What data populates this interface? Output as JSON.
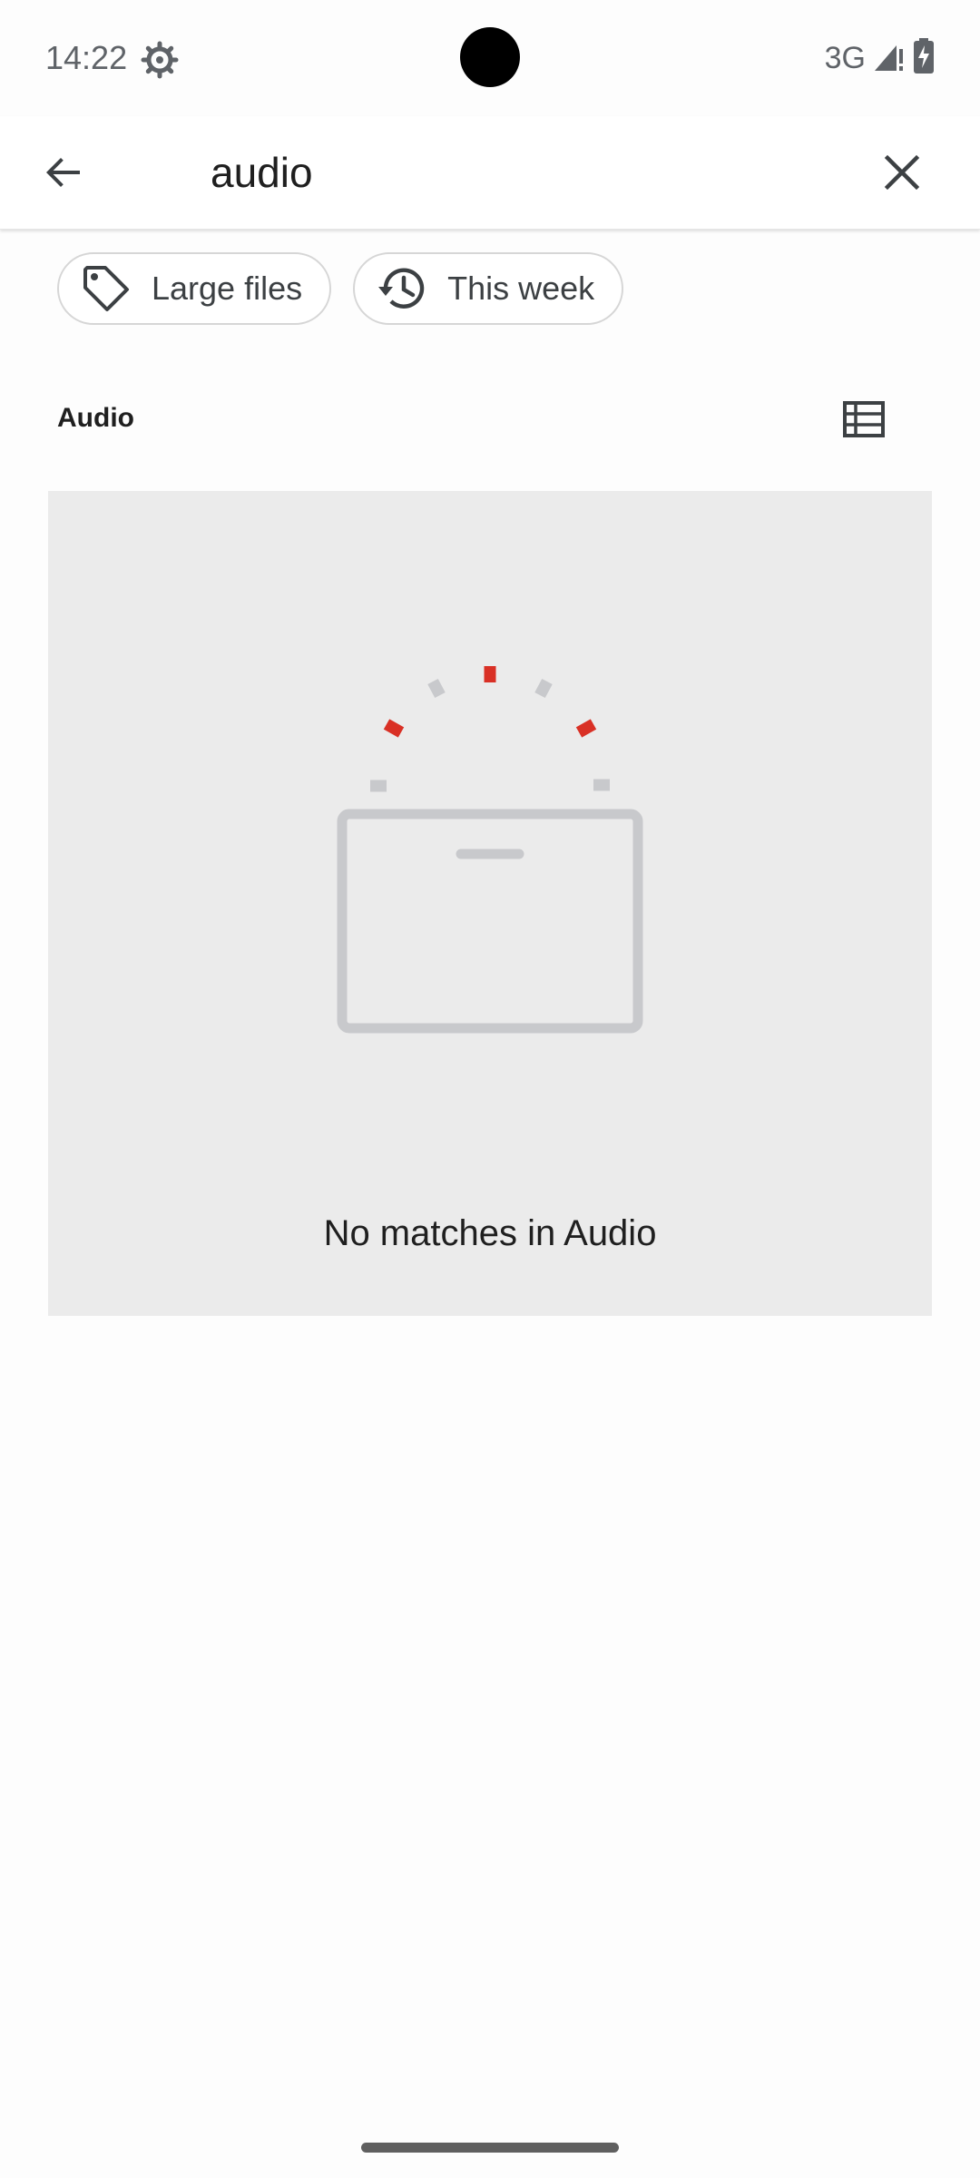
{
  "status_bar": {
    "time": "14:22",
    "network": "3G",
    "icons": [
      "settings-gear-icon",
      "signal-icon",
      "battery-charging-icon"
    ]
  },
  "search": {
    "query": "audio",
    "back_icon": "arrow-back-icon",
    "clear_icon": "close-icon"
  },
  "chips": [
    {
      "label": "Large files",
      "icon": "tag-icon"
    },
    {
      "label": "This week",
      "icon": "history-icon"
    }
  ],
  "section": {
    "title": "Audio",
    "view_icon": "list-view-icon"
  },
  "empty_state": {
    "message": "No matches in Audio",
    "accent_color": "#d93025"
  },
  "colors": {
    "panel_background": "#ebebeb",
    "illustration_gray": "#c8c9cc",
    "accent_red": "#d93025"
  }
}
